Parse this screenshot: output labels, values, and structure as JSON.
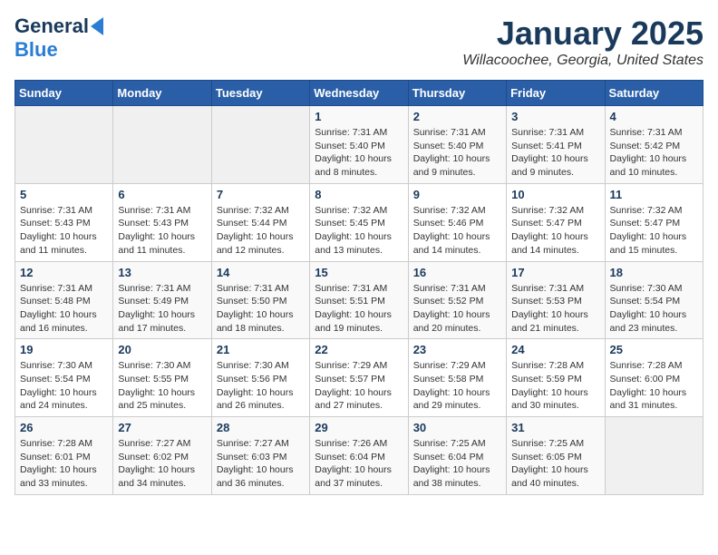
{
  "header": {
    "logo_general": "General",
    "logo_blue": "Blue",
    "month": "January 2025",
    "location": "Willacoochee, Georgia, United States"
  },
  "weekdays": [
    "Sunday",
    "Monday",
    "Tuesday",
    "Wednesday",
    "Thursday",
    "Friday",
    "Saturday"
  ],
  "weeks": [
    [
      {
        "day": "",
        "info": ""
      },
      {
        "day": "",
        "info": ""
      },
      {
        "day": "",
        "info": ""
      },
      {
        "day": "1",
        "info": "Sunrise: 7:31 AM\nSunset: 5:40 PM\nDaylight: 10 hours and 8 minutes."
      },
      {
        "day": "2",
        "info": "Sunrise: 7:31 AM\nSunset: 5:40 PM\nDaylight: 10 hours and 9 minutes."
      },
      {
        "day": "3",
        "info": "Sunrise: 7:31 AM\nSunset: 5:41 PM\nDaylight: 10 hours and 9 minutes."
      },
      {
        "day": "4",
        "info": "Sunrise: 7:31 AM\nSunset: 5:42 PM\nDaylight: 10 hours and 10 minutes."
      }
    ],
    [
      {
        "day": "5",
        "info": "Sunrise: 7:31 AM\nSunset: 5:43 PM\nDaylight: 10 hours and 11 minutes."
      },
      {
        "day": "6",
        "info": "Sunrise: 7:31 AM\nSunset: 5:43 PM\nDaylight: 10 hours and 11 minutes."
      },
      {
        "day": "7",
        "info": "Sunrise: 7:32 AM\nSunset: 5:44 PM\nDaylight: 10 hours and 12 minutes."
      },
      {
        "day": "8",
        "info": "Sunrise: 7:32 AM\nSunset: 5:45 PM\nDaylight: 10 hours and 13 minutes."
      },
      {
        "day": "9",
        "info": "Sunrise: 7:32 AM\nSunset: 5:46 PM\nDaylight: 10 hours and 14 minutes."
      },
      {
        "day": "10",
        "info": "Sunrise: 7:32 AM\nSunset: 5:47 PM\nDaylight: 10 hours and 14 minutes."
      },
      {
        "day": "11",
        "info": "Sunrise: 7:32 AM\nSunset: 5:47 PM\nDaylight: 10 hours and 15 minutes."
      }
    ],
    [
      {
        "day": "12",
        "info": "Sunrise: 7:31 AM\nSunset: 5:48 PM\nDaylight: 10 hours and 16 minutes."
      },
      {
        "day": "13",
        "info": "Sunrise: 7:31 AM\nSunset: 5:49 PM\nDaylight: 10 hours and 17 minutes."
      },
      {
        "day": "14",
        "info": "Sunrise: 7:31 AM\nSunset: 5:50 PM\nDaylight: 10 hours and 18 minutes."
      },
      {
        "day": "15",
        "info": "Sunrise: 7:31 AM\nSunset: 5:51 PM\nDaylight: 10 hours and 19 minutes."
      },
      {
        "day": "16",
        "info": "Sunrise: 7:31 AM\nSunset: 5:52 PM\nDaylight: 10 hours and 20 minutes."
      },
      {
        "day": "17",
        "info": "Sunrise: 7:31 AM\nSunset: 5:53 PM\nDaylight: 10 hours and 21 minutes."
      },
      {
        "day": "18",
        "info": "Sunrise: 7:30 AM\nSunset: 5:54 PM\nDaylight: 10 hours and 23 minutes."
      }
    ],
    [
      {
        "day": "19",
        "info": "Sunrise: 7:30 AM\nSunset: 5:54 PM\nDaylight: 10 hours and 24 minutes."
      },
      {
        "day": "20",
        "info": "Sunrise: 7:30 AM\nSunset: 5:55 PM\nDaylight: 10 hours and 25 minutes."
      },
      {
        "day": "21",
        "info": "Sunrise: 7:30 AM\nSunset: 5:56 PM\nDaylight: 10 hours and 26 minutes."
      },
      {
        "day": "22",
        "info": "Sunrise: 7:29 AM\nSunset: 5:57 PM\nDaylight: 10 hours and 27 minutes."
      },
      {
        "day": "23",
        "info": "Sunrise: 7:29 AM\nSunset: 5:58 PM\nDaylight: 10 hours and 29 minutes."
      },
      {
        "day": "24",
        "info": "Sunrise: 7:28 AM\nSunset: 5:59 PM\nDaylight: 10 hours and 30 minutes."
      },
      {
        "day": "25",
        "info": "Sunrise: 7:28 AM\nSunset: 6:00 PM\nDaylight: 10 hours and 31 minutes."
      }
    ],
    [
      {
        "day": "26",
        "info": "Sunrise: 7:28 AM\nSunset: 6:01 PM\nDaylight: 10 hours and 33 minutes."
      },
      {
        "day": "27",
        "info": "Sunrise: 7:27 AM\nSunset: 6:02 PM\nDaylight: 10 hours and 34 minutes."
      },
      {
        "day": "28",
        "info": "Sunrise: 7:27 AM\nSunset: 6:03 PM\nDaylight: 10 hours and 36 minutes."
      },
      {
        "day": "29",
        "info": "Sunrise: 7:26 AM\nSunset: 6:04 PM\nDaylight: 10 hours and 37 minutes."
      },
      {
        "day": "30",
        "info": "Sunrise: 7:25 AM\nSunset: 6:04 PM\nDaylight: 10 hours and 38 minutes."
      },
      {
        "day": "31",
        "info": "Sunrise: 7:25 AM\nSunset: 6:05 PM\nDaylight: 10 hours and 40 minutes."
      },
      {
        "day": "",
        "info": ""
      }
    ]
  ]
}
